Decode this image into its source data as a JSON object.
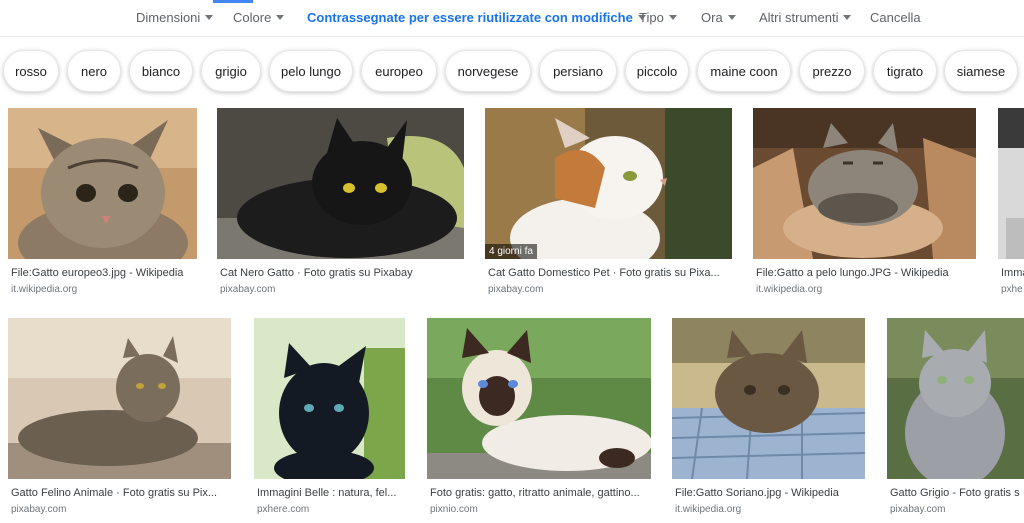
{
  "toolbar": {
    "items": [
      {
        "label": "Dimensioni"
      },
      {
        "label": "Colore"
      },
      {
        "label": "Contrassegnate per essere riutilizzate con modifiche"
      },
      {
        "label": "Tipo"
      },
      {
        "label": "Ora"
      },
      {
        "label": "Altri strumenti"
      },
      {
        "label": "Cancella"
      }
    ],
    "accent_color": "#1a73e8"
  },
  "chips": [
    {
      "label": "rosso"
    },
    {
      "label": "nero"
    },
    {
      "label": "bianco"
    },
    {
      "label": "grigio"
    },
    {
      "label": "pelo lungo"
    },
    {
      "label": "europeo"
    },
    {
      "label": "norvegese"
    },
    {
      "label": "persiano"
    },
    {
      "label": "piccolo"
    },
    {
      "label": "maine coon"
    },
    {
      "label": "prezzo"
    },
    {
      "label": "tigrato"
    },
    {
      "label": "siamese"
    }
  ],
  "results": [
    {
      "title": "File:Gatto europeo3.jpg - Wikipedia",
      "source": "it.wikipedia.org"
    },
    {
      "title": "Cat Nero Gatto · Foto gratis su Pixabay",
      "source": "pixabay.com"
    },
    {
      "title": "Cat Gatto Domestico Pet · Foto gratis su Pixa...",
      "source": "pixabay.com",
      "badge": "4 giorni fa"
    },
    {
      "title": "File:Gatto a pelo lungo.JPG - Wikipedia",
      "source": "it.wikipedia.org"
    },
    {
      "title": "Imma",
      "source": "pxhe"
    },
    {
      "title": "Gatto Felino Animale · Foto gratis su Pix...",
      "source": "pixabay.com"
    },
    {
      "title": "Immagini Belle : natura, fel...",
      "source": "pxhere.com"
    },
    {
      "title": "Foto gratis: gatto, ritratto animale, gattino...",
      "source": "pixnio.com"
    },
    {
      "title": "File:Gatto Soriano.jpg - Wikipedia",
      "source": "it.wikipedia.org"
    },
    {
      "title": "Gatto Grigio - Foto gratis s",
      "source": "pixabay.com"
    }
  ]
}
